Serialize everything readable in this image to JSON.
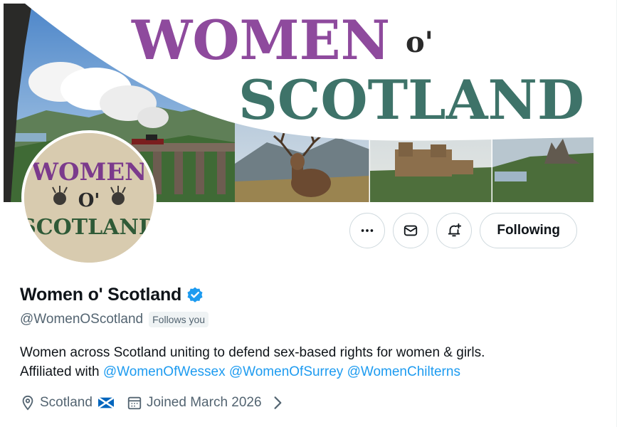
{
  "banner": {
    "title_line1": "WOMEN",
    "title_connector": "o'",
    "title_line2": "SCOTLAND"
  },
  "avatar": {
    "line1": "WOMEN",
    "line2": "O'",
    "line3": "SCOTLAND"
  },
  "actions": {
    "more_icon": "more-icon",
    "message_icon": "mail-icon",
    "notify_icon": "bell-plus-icon",
    "follow_label": "Following"
  },
  "profile": {
    "display_name": "Women o' Scotland",
    "handle": "@WomenOScotland",
    "follows_badge": "Follows you",
    "bio_line1": "Women across Scotland uniting to defend sex-based rights for women & girls.",
    "bio_prefix": "Affiliated with",
    "bio_mentions": [
      "@WomenOfWessex",
      "@WomenOfSurrey",
      "@WomenChilterns"
    ],
    "location": "Scotland",
    "joined": "Joined March 2026"
  },
  "colors": {
    "accent": "#1d9bf0",
    "banner_purple": "#8e4a9d",
    "banner_teal": "#3e7369",
    "avatar_purple": "#7b3a8c",
    "avatar_green": "#2f5a37",
    "secondary_text": "#536471",
    "badge_bg": "#eff3f4"
  }
}
